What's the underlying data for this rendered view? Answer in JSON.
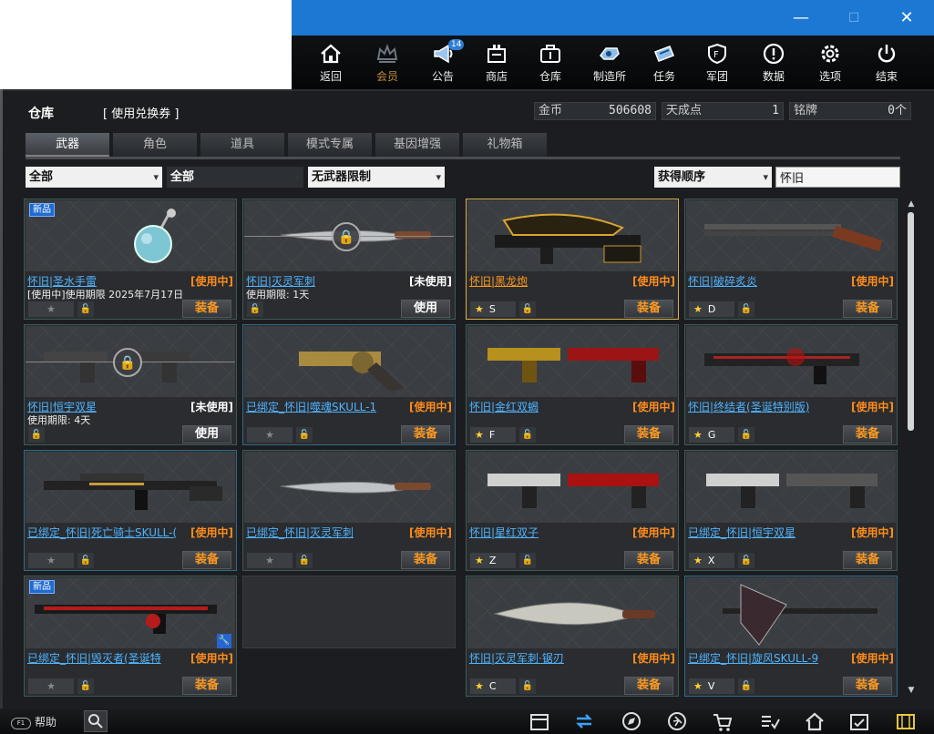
{
  "window": {
    "minimize_label": "—",
    "maximize_label": "☐",
    "close_label": "✕"
  },
  "nav": {
    "items": [
      {
        "label": "返回",
        "icon": "home-icon"
      },
      {
        "label": "会员",
        "icon": "crown-icon"
      },
      {
        "label": "公告",
        "icon": "megaphone-icon",
        "badge": "14"
      },
      {
        "label": "商店",
        "icon": "shop-icon"
      },
      {
        "label": "仓库",
        "icon": "briefcase-icon"
      },
      {
        "label": "制造所",
        "icon": "factory-icon"
      },
      {
        "label": "任务",
        "icon": "ticket-icon"
      },
      {
        "label": "军团",
        "icon": "shield-icon"
      },
      {
        "label": "数据",
        "icon": "alert-circle-icon"
      },
      {
        "label": "选项",
        "icon": "gear-icon"
      },
      {
        "label": "结束",
        "icon": "power-icon"
      }
    ]
  },
  "header": {
    "title": "仓库",
    "redeem_label": "[ 使用兑换券 ]",
    "gold_label": "金币",
    "gold_value": "506608",
    "tiancheng_label": "天成点",
    "tiancheng_value": "1",
    "medal_label": "铭牌",
    "medal_value": "0个"
  },
  "tabs": [
    "武器",
    "角色",
    "道具",
    "模式专属",
    "基因增强",
    "礼物箱"
  ],
  "filters": {
    "category": "全部",
    "subcategory": "全部",
    "restriction": "无武器限制",
    "sort": "获得顺序",
    "search_value": "怀旧"
  },
  "left_cards": [
    {
      "name": "怀旧|圣水手雷",
      "status": "[使用中]",
      "desc": "[使用中]使用期限 2025年7月17日",
      "new": "新品",
      "action": "装备",
      "locked": false,
      "lock_style": "blue",
      "show_grade": true,
      "grade": "★",
      "border": "teal"
    },
    {
      "name": "怀旧|灭灵军刺",
      "status": "[未使用]",
      "desc": "使用期限: 1天",
      "action": "使用",
      "locked": true,
      "lock_style": "blue",
      "show_grade": false,
      "border": "teal"
    },
    {
      "name": "怀旧|恒宇双星",
      "status": "[未使用]",
      "desc": "使用期限: 4天",
      "action": "使用",
      "locked": true,
      "lock_style": "blue",
      "show_grade": false,
      "border": "teal"
    },
    {
      "name": "已绑定_怀旧|噬魂SKULL-1",
      "status": "[使用中]",
      "action": "装备",
      "locked": false,
      "lock_style": "gold",
      "show_grade": true,
      "grade": "★",
      "border": "blue"
    },
    {
      "name": "已绑定_怀旧|死亡骑士SKULL-(",
      "status": "[使用中]",
      "action": "装备",
      "locked": false,
      "lock_style": "gold",
      "show_grade": true,
      "grade": "★",
      "border": "blue"
    },
    {
      "name": "已绑定_怀旧|灭灵军刺",
      "status": "[使用中]",
      "action": "装备",
      "locked": false,
      "lock_style": "gold",
      "show_grade": true,
      "grade": "★",
      "border": "teal"
    },
    {
      "name": "已绑定_怀旧|毁灭者(圣诞特",
      "status": "[使用中]",
      "new": "新品",
      "action": "装备",
      "locked": false,
      "lock_style": "gold",
      "show_grade": true,
      "grade": "★",
      "border": "teal",
      "wrench": true
    }
  ],
  "right_cards": [
    {
      "name": "怀旧|黑龙炮",
      "status": "[使用中]",
      "grade": "★",
      "letter": "S",
      "action": "装备",
      "border": "gold",
      "name_color": "orange"
    },
    {
      "name": "怀旧|破碎炙炎",
      "status": "[使用中]",
      "grade": "★",
      "letter": "D",
      "action": "装备",
      "border": "teal"
    },
    {
      "name": "怀旧|金红双蝎",
      "status": "[使用中]",
      "grade": "★",
      "letter": "F",
      "action": "装备",
      "border": "teal"
    },
    {
      "name": "怀旧|终结者(圣诞特别版)",
      "status": "[使用中]",
      "grade": "★",
      "letter": "G",
      "action": "装备",
      "border": "teal"
    },
    {
      "name": "怀旧|星红双子",
      "status": "[使用中]",
      "grade": "★",
      "letter": "Z",
      "action": "装备",
      "border": "teal"
    },
    {
      "name": "已绑定_怀旧|恒宇双星",
      "status": "[使用中]",
      "grade": "★",
      "letter": "X",
      "action": "装备",
      "border": "teal",
      "lock_gold": true
    },
    {
      "name": "怀旧|灭灵军刺·锯刃",
      "status": "[使用中]",
      "grade": "★",
      "letter": "C",
      "action": "装备",
      "border": "teal"
    },
    {
      "name": "已绑定_怀旧|旋风SKULL-9",
      "status": "[使用中]",
      "grade": "★",
      "letter": "V",
      "action": "装备",
      "border": "blue",
      "lock_gold": true
    }
  ],
  "bottom": {
    "help_label": "帮助",
    "help_key": "F1"
  },
  "colors": {
    "accent_blue": "#1c78d3",
    "status_orange": "#ff8c1a",
    "link_blue": "#4fb4ff",
    "gold_border": "#d6b24a"
  }
}
